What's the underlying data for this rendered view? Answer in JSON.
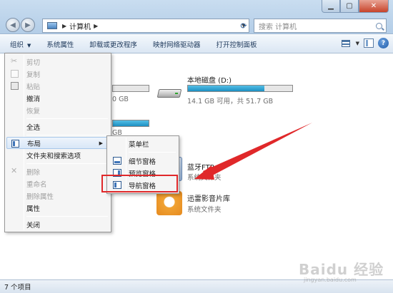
{
  "address": {
    "crumb": "计算机",
    "search_placeholder": "搜索 计算机"
  },
  "toolbar": {
    "organize": "组织",
    "system_properties": "系统属性",
    "uninstall": "卸载或更改程序",
    "map_drive": "映射网络驱动器",
    "control_panel": "打开控制面板"
  },
  "content": {
    "left_drive_free_text": "0 GB",
    "left_drive2_text": "GB",
    "drive_d": {
      "name": "本地磁盘 (D:)",
      "info": "14.1 GB 可用，共 51.7 GB",
      "used_fraction": 0.73
    },
    "items": [
      {
        "name": "蓝牙FTP",
        "type": "系统文件夹"
      },
      {
        "name": "迅雷影音片库",
        "type": "系统文件夹"
      }
    ]
  },
  "menu": {
    "cut": "剪切",
    "copy": "复制",
    "paste": "粘贴",
    "undo": "撤消",
    "redo": "恢复",
    "select_all": "全选",
    "layout": "布局",
    "folder_options": "文件夹和搜索选项",
    "delete": "删除",
    "rename": "重命名",
    "remove_properties": "删除属性",
    "properties": "属性",
    "close": "关闭"
  },
  "submenu": {
    "menubar": "菜单栏",
    "details_pane": "细节窗格",
    "preview_pane": "预览窗格",
    "nav_pane": "导航窗格"
  },
  "status": {
    "text": "7 个项目"
  },
  "watermark": {
    "brand": "Baidu 经验",
    "url": "jingyan.baidu.com"
  }
}
